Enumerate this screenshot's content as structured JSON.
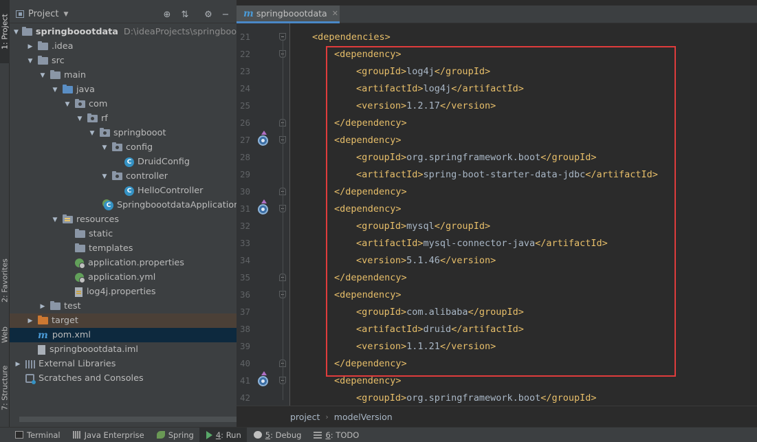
{
  "left_strip": {
    "tabs": [
      {
        "label": "1: Project",
        "active": true
      },
      {
        "label": "2: Favorites",
        "active": false
      },
      {
        "label": "Web",
        "active": false
      },
      {
        "label": "7: Structure",
        "active": false
      }
    ]
  },
  "project_panel": {
    "title": "Project",
    "tree": [
      {
        "label": "springboootdata",
        "hint": "D:\\ideaProjects\\springboootda",
        "icon": "module-folder-icon",
        "depth": 0,
        "expanded": true
      },
      {
        "label": ".idea",
        "icon": "folder-icon",
        "depth": 1,
        "expanded": false
      },
      {
        "label": "src",
        "icon": "folder-icon",
        "depth": 1,
        "expanded": true
      },
      {
        "label": "main",
        "icon": "folder-icon",
        "depth": 2,
        "expanded": true
      },
      {
        "label": "java",
        "icon": "source-folder-icon",
        "depth": 3,
        "expanded": true
      },
      {
        "label": "com",
        "icon": "package-icon",
        "depth": 4,
        "expanded": true
      },
      {
        "label": "rf",
        "icon": "package-icon",
        "depth": 5,
        "expanded": true
      },
      {
        "label": "springbooot",
        "icon": "package-icon",
        "depth": 6,
        "expanded": true
      },
      {
        "label": "config",
        "icon": "package-icon",
        "depth": 7,
        "expanded": true
      },
      {
        "label": "DruidConfig",
        "icon": "class-icon",
        "depth": 8
      },
      {
        "label": "controller",
        "icon": "package-icon",
        "depth": 7,
        "expanded": true
      },
      {
        "label": "HelloController",
        "icon": "class-icon",
        "depth": 8
      },
      {
        "label": "SpringboootdataApplication",
        "icon": "spring-class-icon",
        "depth": 7
      },
      {
        "label": "resources",
        "icon": "resources-folder-icon",
        "depth": 3,
        "expanded": true
      },
      {
        "label": "static",
        "icon": "folder-icon",
        "depth": 4
      },
      {
        "label": "templates",
        "icon": "folder-icon",
        "depth": 4
      },
      {
        "label": "application.properties",
        "icon": "spring-properties-icon",
        "depth": 4
      },
      {
        "label": "application.yml",
        "icon": "spring-yml-icon",
        "depth": 4
      },
      {
        "label": "log4j.properties",
        "icon": "properties-file-icon",
        "depth": 4
      },
      {
        "label": "test",
        "icon": "folder-icon",
        "depth": 2,
        "expanded": false
      },
      {
        "label": "target",
        "icon": "excluded-folder-icon",
        "depth": 1,
        "expanded": false
      },
      {
        "label": "pom.xml",
        "icon": "maven-icon",
        "depth": 1,
        "selected": true
      },
      {
        "label": "springboootdata.iml",
        "icon": "iml-file-icon",
        "depth": 1
      },
      {
        "label": "External Libraries",
        "icon": "libraries-icon",
        "depth": 0,
        "expanded": false
      },
      {
        "label": "Scratches and Consoles",
        "icon": "scratches-icon",
        "depth": 0
      }
    ]
  },
  "editor": {
    "tab_label": "springboootdata",
    "lines": [
      {
        "num": "21",
        "indent": 0,
        "open": "dependencies",
        "text": "",
        "close": ""
      },
      {
        "num": "22",
        "indent": 1,
        "open": "dependency",
        "text": "",
        "close": ""
      },
      {
        "num": "23",
        "indent": 2,
        "open": "groupId",
        "text": "log4j",
        "close": "groupId"
      },
      {
        "num": "24",
        "indent": 2,
        "open": "artifactId",
        "text": "log4j",
        "close": "artifactId"
      },
      {
        "num": "25",
        "indent": 2,
        "open": "version",
        "text": "1.2.17",
        "close": "version"
      },
      {
        "num": "26",
        "indent": 1,
        "open": "",
        "text": "",
        "close": "dependency"
      },
      {
        "num": "27",
        "indent": 1,
        "open": "dependency",
        "text": "",
        "close": ""
      },
      {
        "num": "28",
        "indent": 2,
        "open": "groupId",
        "text": "org.springframework.boot",
        "close": "groupId"
      },
      {
        "num": "29",
        "indent": 2,
        "open": "artifactId",
        "text": "spring-boot-starter-data-jdbc",
        "close": "artifactId"
      },
      {
        "num": "30",
        "indent": 1,
        "open": "",
        "text": "",
        "close": "dependency"
      },
      {
        "num": "31",
        "indent": 1,
        "open": "dependency",
        "text": "",
        "close": ""
      },
      {
        "num": "32",
        "indent": 2,
        "open": "groupId",
        "text": "mysql",
        "close": "groupId"
      },
      {
        "num": "33",
        "indent": 2,
        "open": "artifactId",
        "text": "mysql-connector-java",
        "close": "artifactId"
      },
      {
        "num": "34",
        "indent": 2,
        "open": "version",
        "text": "5.1.46",
        "close": "version"
      },
      {
        "num": "35",
        "indent": 1,
        "open": "",
        "text": "",
        "close": "dependency"
      },
      {
        "num": "36",
        "indent": 1,
        "open": "dependency",
        "text": "",
        "close": ""
      },
      {
        "num": "37",
        "indent": 2,
        "open": "groupId",
        "text": "com.alibaba",
        "close": "groupId"
      },
      {
        "num": "38",
        "indent": 2,
        "open": "artifactId",
        "text": "druid",
        "close": "artifactId"
      },
      {
        "num": "39",
        "indent": 2,
        "open": "version",
        "text": "1.1.21",
        "close": "version"
      },
      {
        "num": "40",
        "indent": 1,
        "open": "",
        "text": "",
        "close": "dependency"
      },
      {
        "num": "41",
        "indent": 1,
        "open": "dependency",
        "text": "",
        "close": ""
      },
      {
        "num": "42",
        "indent": 2,
        "open": "groupId",
        "text": "org.springframework.boot",
        "close": "groupId"
      }
    ],
    "breadcrumb": [
      "project",
      "modelVersion"
    ]
  },
  "bottom_bar": {
    "tabs": [
      {
        "label": "Terminal",
        "mnemonic": "",
        "icon": "terminal-icon"
      },
      {
        "label": "Java Enterprise",
        "mnemonic": "",
        "icon": "java-enterprise-icon"
      },
      {
        "label": "Spring",
        "mnemonic": "",
        "icon": "spring-icon"
      },
      {
        "label": ": Run",
        "mnemonic": "4",
        "icon": "run-icon",
        "active": true
      },
      {
        "label": ": Debug",
        "mnemonic": "5",
        "icon": "debug-icon"
      },
      {
        "label": ": TODO",
        "mnemonic": "6",
        "icon": "todo-icon"
      }
    ]
  },
  "colors": {
    "tag": "#e8bf6a",
    "text": "#a9b7c6",
    "highlight_box": "#e03c3c",
    "selection": "#0d293e"
  }
}
